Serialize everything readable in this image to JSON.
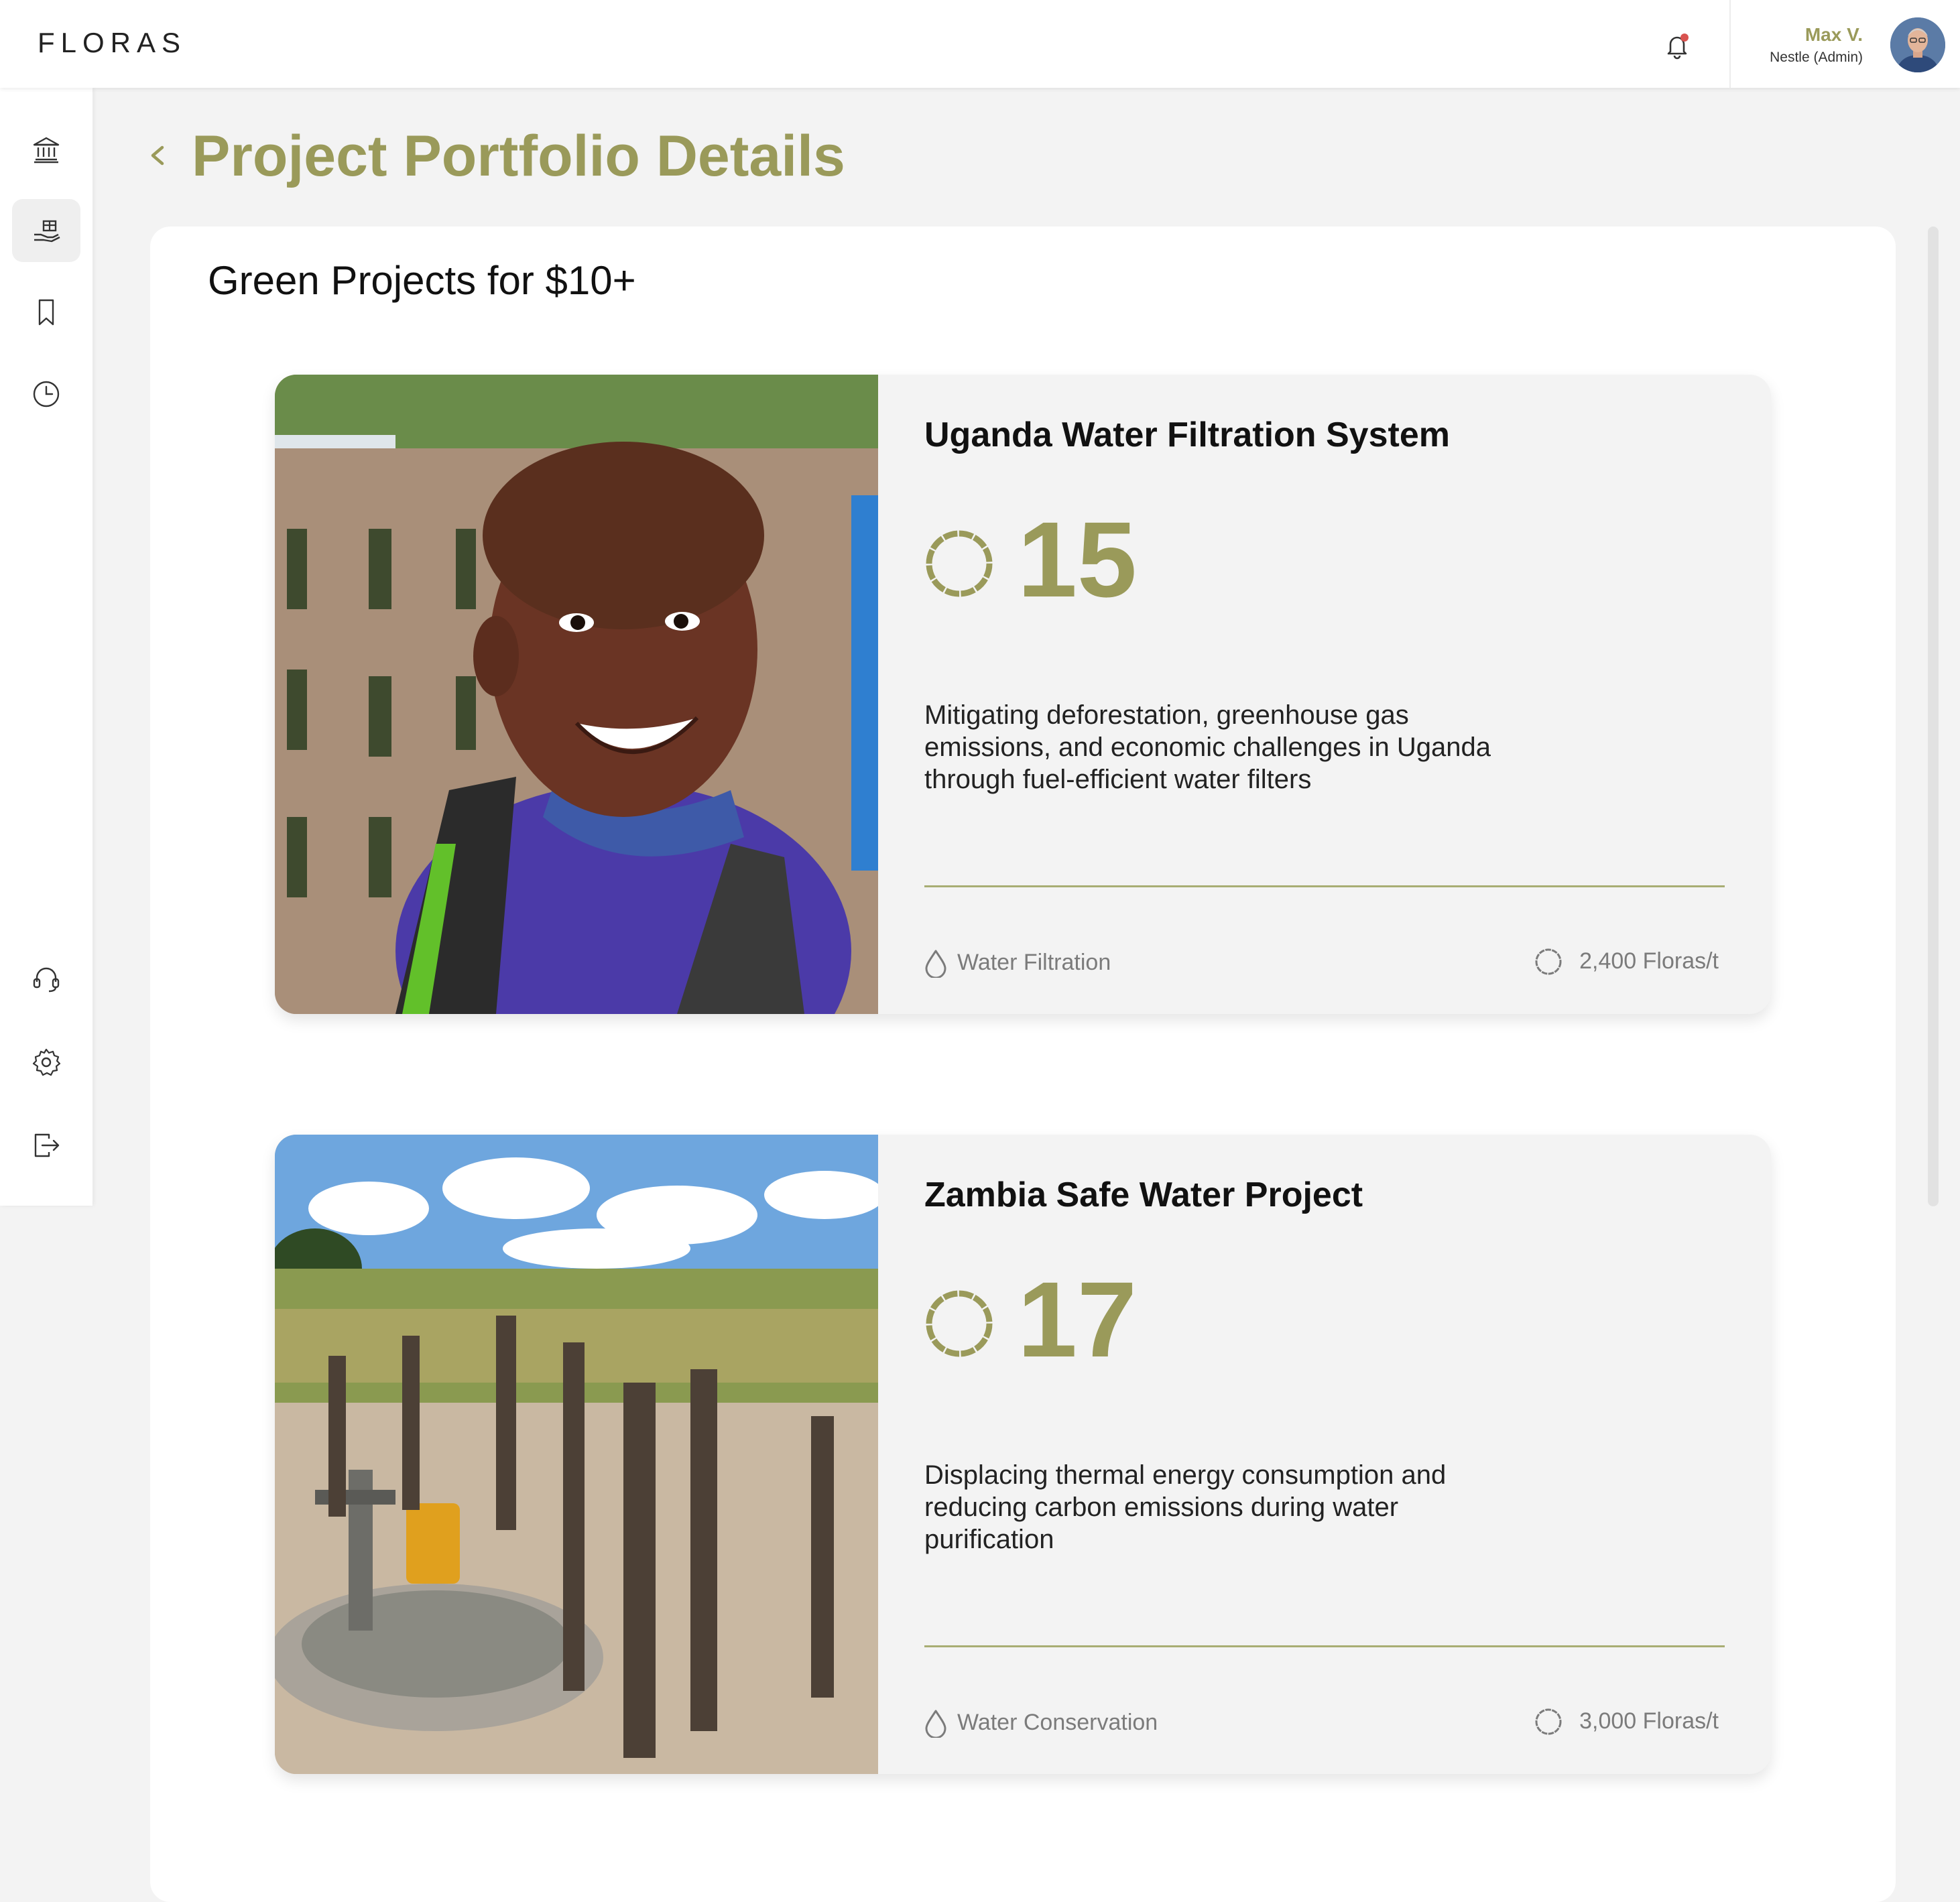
{
  "app": {
    "logo": "FLORAS"
  },
  "header": {
    "user": {
      "name": "Max V.",
      "role": "Nestle (Admin)"
    },
    "notification": {
      "icon": "bell-icon",
      "has_unread": true,
      "dot_color": "#d9534f"
    }
  },
  "sidebar": {
    "items": [
      {
        "name": "bank",
        "icon": "bank-icon",
        "active": false
      },
      {
        "name": "projects",
        "icon": "hand-gift-icon",
        "active": true
      },
      {
        "name": "bookmarks",
        "icon": "bookmark-icon",
        "active": false
      },
      {
        "name": "history",
        "icon": "clock-icon",
        "active": false
      },
      {
        "name": "support",
        "icon": "headset-icon",
        "active": false
      },
      {
        "name": "settings",
        "icon": "gear-icon",
        "active": false
      },
      {
        "name": "logout",
        "icon": "logout-icon",
        "active": false
      }
    ]
  },
  "page": {
    "title": "Project Portfolio Details",
    "section_title": "Green Projects for $10+"
  },
  "projects": [
    {
      "title": "Uganda Water Filtration System",
      "score": "15",
      "description": "Mitigating deforestation, greenhouse gas emissions, and economic challenges in Uganda through fuel-efficient water filters",
      "category": "Water Filtration",
      "category_icon": "water-drop-icon",
      "price": "2,400 Floras/t",
      "image": "photo of smiling child with backpack"
    },
    {
      "title": "Zambia Safe Water Project",
      "score": "17",
      "description": "Displacing thermal energy consumption and reducing carbon emissions during water purification",
      "category": "Water Conservation",
      "category_icon": "water-drop-icon",
      "price": "3,000 Floras/t",
      "image": "photo of water hand pump with wooden fence posts"
    }
  ],
  "colors": {
    "accent": "#9a9a5a",
    "rule": "#a8ad73",
    "background": "#f3f3f3",
    "card": "#f3f3f3",
    "panel": "#ffffff"
  }
}
